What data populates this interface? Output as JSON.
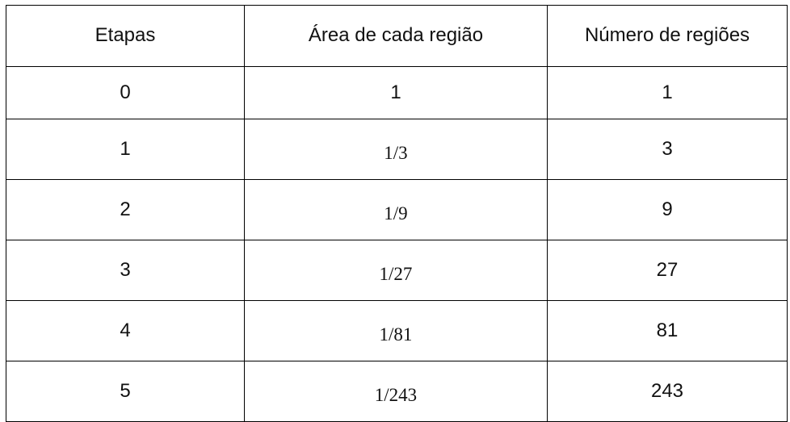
{
  "table": {
    "headers": [
      "Etapas",
      "Área de cada região",
      "Número de regiões"
    ],
    "rows": [
      [
        "0",
        "1",
        "1"
      ],
      [
        "1",
        "1/3",
        "3"
      ],
      [
        "2",
        "1/9",
        "9"
      ],
      [
        "3",
        "1/27",
        "27"
      ],
      [
        "4",
        "1/81",
        "81"
      ],
      [
        "5",
        "1/243",
        "243"
      ]
    ]
  }
}
